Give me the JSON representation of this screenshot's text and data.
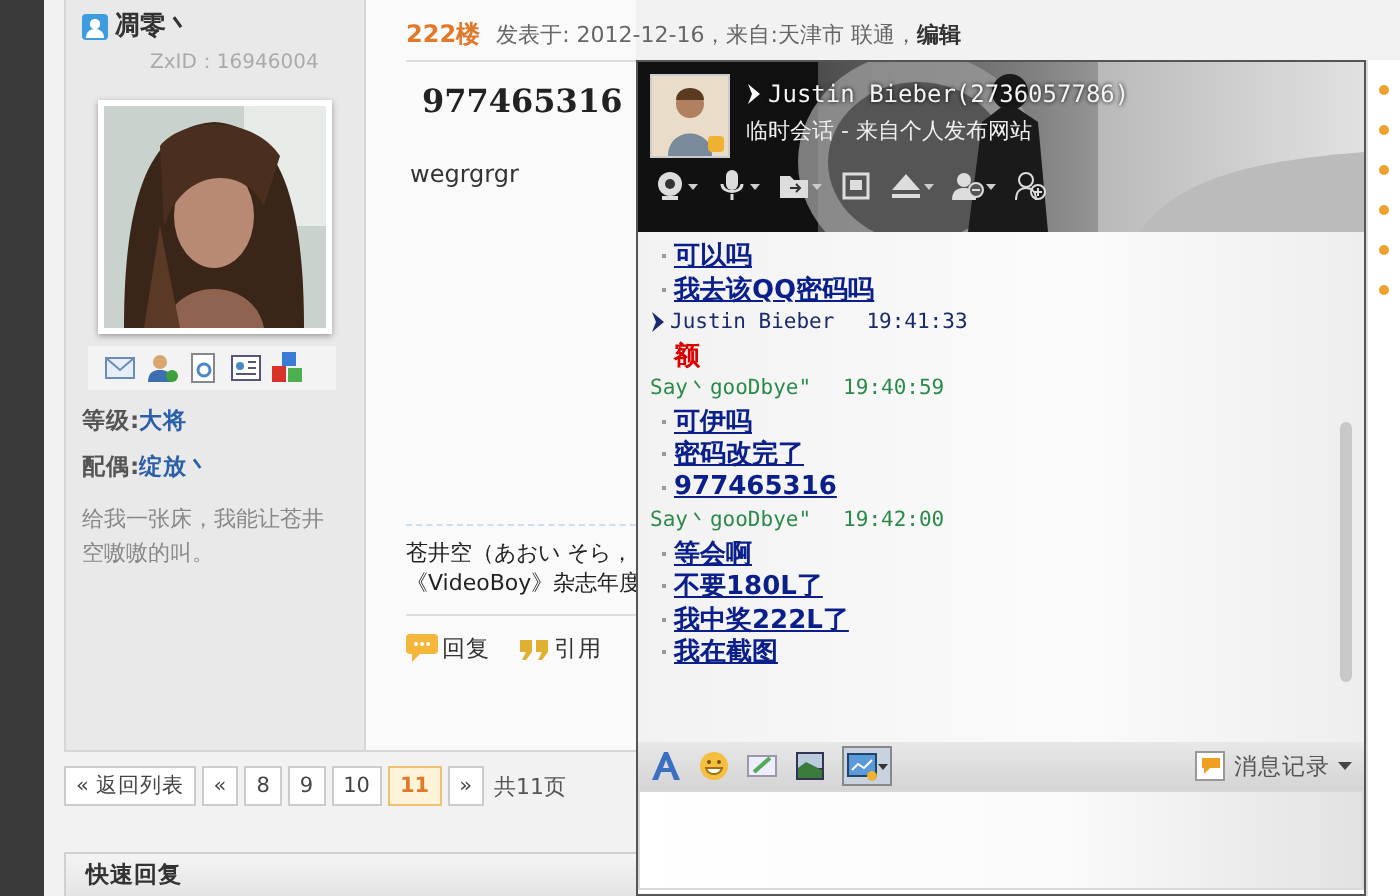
{
  "forum": {
    "user": {
      "name": "凋零丶",
      "zxid": "ZxID：16946004",
      "level_label": "等级:",
      "level": "大将",
      "spouse_label": "配偶:",
      "spouse": "绽放丶",
      "signature": "给我一张床，我能让苍井空嗷嗷的叫。"
    },
    "post": {
      "floor": "222楼",
      "meta": "发表于: 2012-12-16，来自:天津市 联通，",
      "edit": "编辑",
      "title": "977465316",
      "body": "wegrgrgr",
      "signature_lines": [
        "苍井空（あおい そら，",
        "《VideoBoy》杂志年度"
      ],
      "actions": [
        {
          "label": "回复",
          "kind": "reply"
        },
        {
          "label": "引用",
          "kind": "quote"
        }
      ]
    },
    "pagination": {
      "back": "« 返回列表",
      "pages": [
        {
          "label": "«",
          "selected": false
        },
        {
          "label": "8",
          "selected": false
        },
        {
          "label": "9",
          "selected": false
        },
        {
          "label": "10",
          "selected": false
        },
        {
          "label": "11",
          "selected": true
        },
        {
          "label": "»",
          "selected": false
        }
      ],
      "total": "共11页"
    },
    "quick_reply": "快速回复"
  },
  "chat": {
    "contact": "Justin Bieber(2736057786)",
    "subtitle": "临时会话 - 来自个人发布网站",
    "messages": [
      {
        "lines": [
          {
            "text": "可以吗",
            "kind": "link"
          },
          {
            "text": "我去该QQ密码吗",
            "kind": "link"
          }
        ]
      },
      {
        "kind": "them",
        "sender": "Justin Bieber",
        "time": "19:41:33",
        "lines": [
          {
            "text": "额",
            "kind": "red"
          }
        ]
      },
      {
        "kind": "me",
        "sender": "Say丶gooDbye\"",
        "time": "19:40:59",
        "lines": [
          {
            "text": "可伊吗",
            "kind": "link"
          },
          {
            "text": "密码改完了",
            "kind": "link"
          },
          {
            "text": "977465316",
            "kind": "link"
          }
        ]
      },
      {
        "kind": "me",
        "sender": "Say丶gooDbye\"",
        "time": "19:42:00",
        "lines": [
          {
            "text": "等会啊",
            "kind": "link"
          },
          {
            "text": "不要180L了",
            "kind": "link"
          },
          {
            "text": "我中奖222L了",
            "kind": "link"
          },
          {
            "text": "我在截图",
            "kind": "link"
          }
        ]
      }
    ],
    "history": "消息记录"
  }
}
